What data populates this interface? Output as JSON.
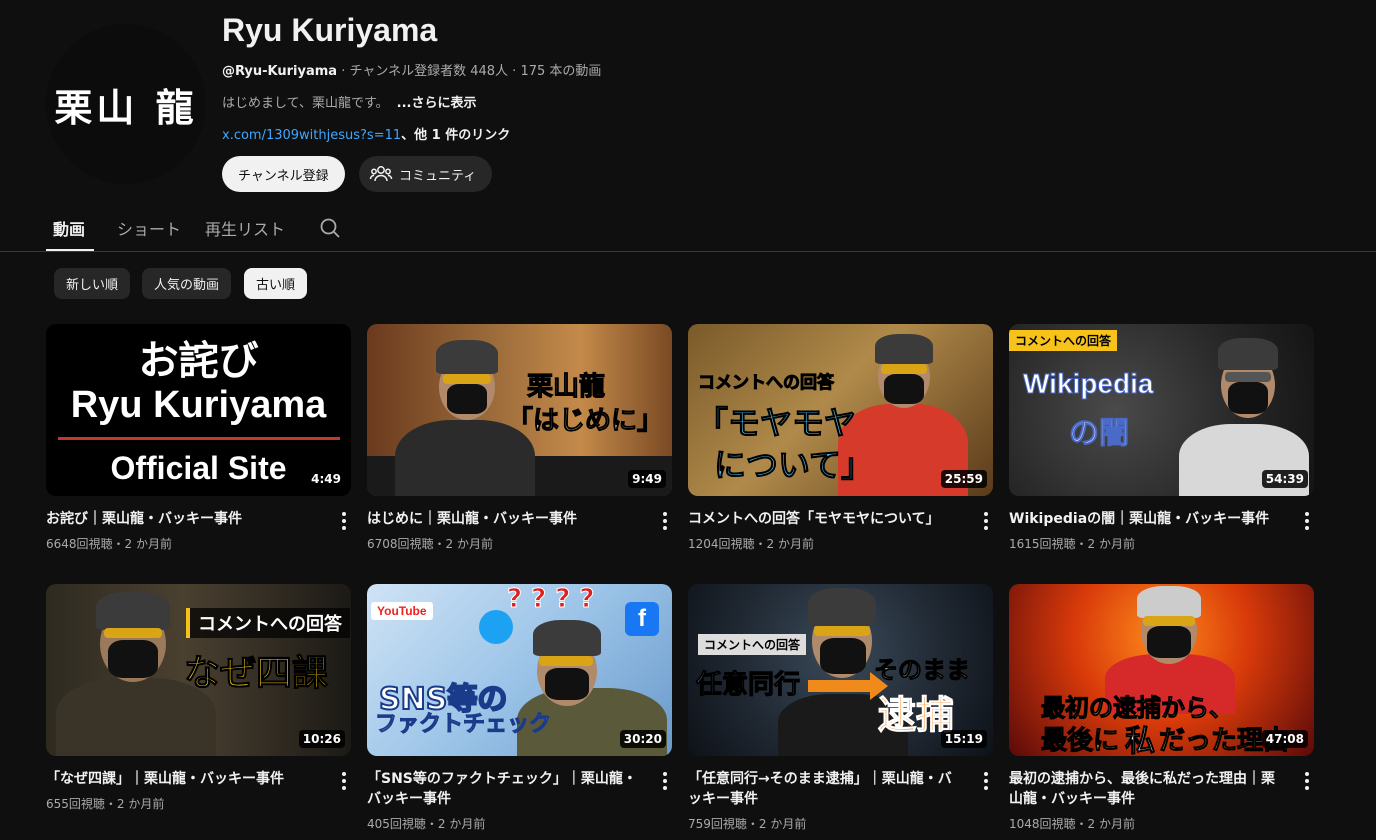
{
  "channel": {
    "avatar_text": "栗山 龍",
    "name": "Ryu Kuriyama",
    "handle": "@Ryu-Kuriyama",
    "stats": " · チャンネル登録者数 448人 · 175 本の動画",
    "description": "はじめまして、栗山龍です。",
    "more_label": "...さらに表示",
    "link": "x.com/1309withjesus?s=11",
    "more_links": "、他 1 件のリンク",
    "subscribe_label": "チャンネル登録",
    "community_label": "コミュニティ"
  },
  "tabs": [
    "動画",
    "ショート",
    "再生リスト"
  ],
  "chips": [
    "新しい順",
    "人気の動画",
    "古い順"
  ],
  "videos": [
    {
      "title": "お詫び｜栗山龍・バッキー事件",
      "meta": "6648回視聴・2 か月前",
      "duration": "4:49",
      "thumb_text": [
        "お詫び",
        "Ryu Kuriyama",
        "Official Site"
      ]
    },
    {
      "title": "はじめに｜栗山龍・バッキー事件",
      "meta": "6708回視聴・2 か月前",
      "duration": "9:49",
      "thumb_text": [
        "栗山龍",
        "「はじめに」"
      ]
    },
    {
      "title": "コメントへの回答「モヤモヤについて」",
      "meta": "1204回視聴・2 か月前",
      "duration": "25:59",
      "thumb_text": [
        "コメントへの回答",
        "「モヤモヤ",
        "について」"
      ]
    },
    {
      "title": "Wikipediaの闇｜栗山龍・バッキー事件",
      "meta": "1615回視聴・2 か月前",
      "duration": "54:39",
      "thumb_text": [
        "コメントへの回答",
        "Wikipedia",
        "の闇"
      ]
    },
    {
      "title": "「なぜ四課」｜栗山龍・バッキー事件",
      "meta": "655回視聴・2 か月前",
      "duration": "10:26",
      "thumb_text": [
        "コメントへの回答",
        "なぜ四課"
      ]
    },
    {
      "title": "「SNS等のファクトチェック」｜栗山龍・バッキー事件",
      "meta": "405回視聴・2 か月前",
      "duration": "30:20",
      "thumb_text": [
        "YouTube",
        "SNS等の",
        "ファクトチェック",
        "? ? ? ?"
      ]
    },
    {
      "title": "「任意同行→そのまま逮捕」｜栗山龍・バッキー事件",
      "meta": "759回視聴・2 か月前",
      "duration": "15:19",
      "thumb_text": [
        "コメントへの回答",
        "任意同行",
        "そのまま",
        "逮捕"
      ]
    },
    {
      "title": "最初の逮捕から、最後に私だった理由｜栗山龍・バッキー事件",
      "meta": "1048回視聴・2 か月前",
      "duration": "47:08",
      "thumb_text": [
        "最初の逮捕から、",
        "最後に",
        "私",
        "だった理由"
      ]
    }
  ],
  "colors": {
    "background": "#0f0f0f",
    "link": "#3ea6ff",
    "chip": "#272727",
    "chip_selected": "#f1f1f1"
  }
}
